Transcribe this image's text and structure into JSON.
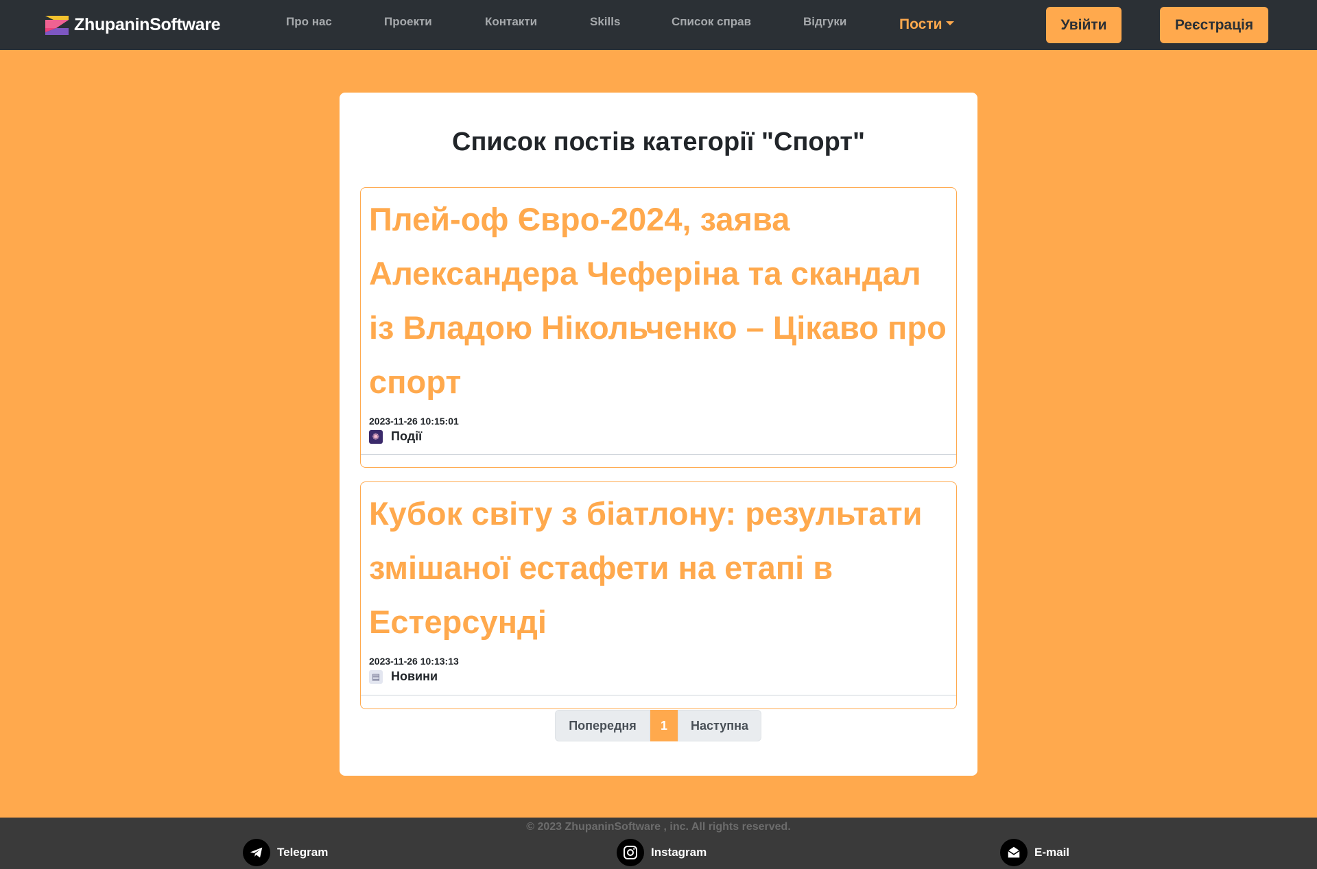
{
  "brand": {
    "name": "ZhupaninSoftware"
  },
  "nav": {
    "items": [
      {
        "label": "Про нас"
      },
      {
        "label": "Проекти"
      },
      {
        "label": "Контакти"
      },
      {
        "label": "Skills"
      },
      {
        "label": "Список справ"
      },
      {
        "label": "Відгуки"
      }
    ],
    "active_dropdown": "Пости",
    "login_label": "Увійти",
    "register_label": "Реєстрація"
  },
  "main": {
    "title": "Список постів категорії \"Спорт\"",
    "posts": [
      {
        "title": "Плей-оф Євро-2024, заява Александера Чеферіна та скандал із Владою Нікольченко – Цікаво про спорт",
        "date": "2023-11-26 10:15:01",
        "category": "Події",
        "category_icon": "fireworks-icon"
      },
      {
        "title": "Кубок світу з біатлону: результати змішаної естафети на етапі в Естерсунді",
        "date": "2023-11-26 10:13:13",
        "category": "Новини",
        "category_icon": "newspaper-icon"
      }
    ]
  },
  "pagination": {
    "prev_label": "Попередня",
    "current_page": "1",
    "next_label": "Наступна"
  },
  "footer": {
    "copyright": "© 2023 ZhupaninSoftware , inc. All rights reserved.",
    "links": [
      {
        "label": "Telegram",
        "icon": "telegram-icon"
      },
      {
        "label": "Instagram",
        "icon": "instagram-icon"
      },
      {
        "label": "E-mail",
        "icon": "email-icon"
      }
    ]
  },
  "colors": {
    "accent": "#FFA94D",
    "navbar": "#2B3035",
    "footer": "#3A3A3A"
  }
}
